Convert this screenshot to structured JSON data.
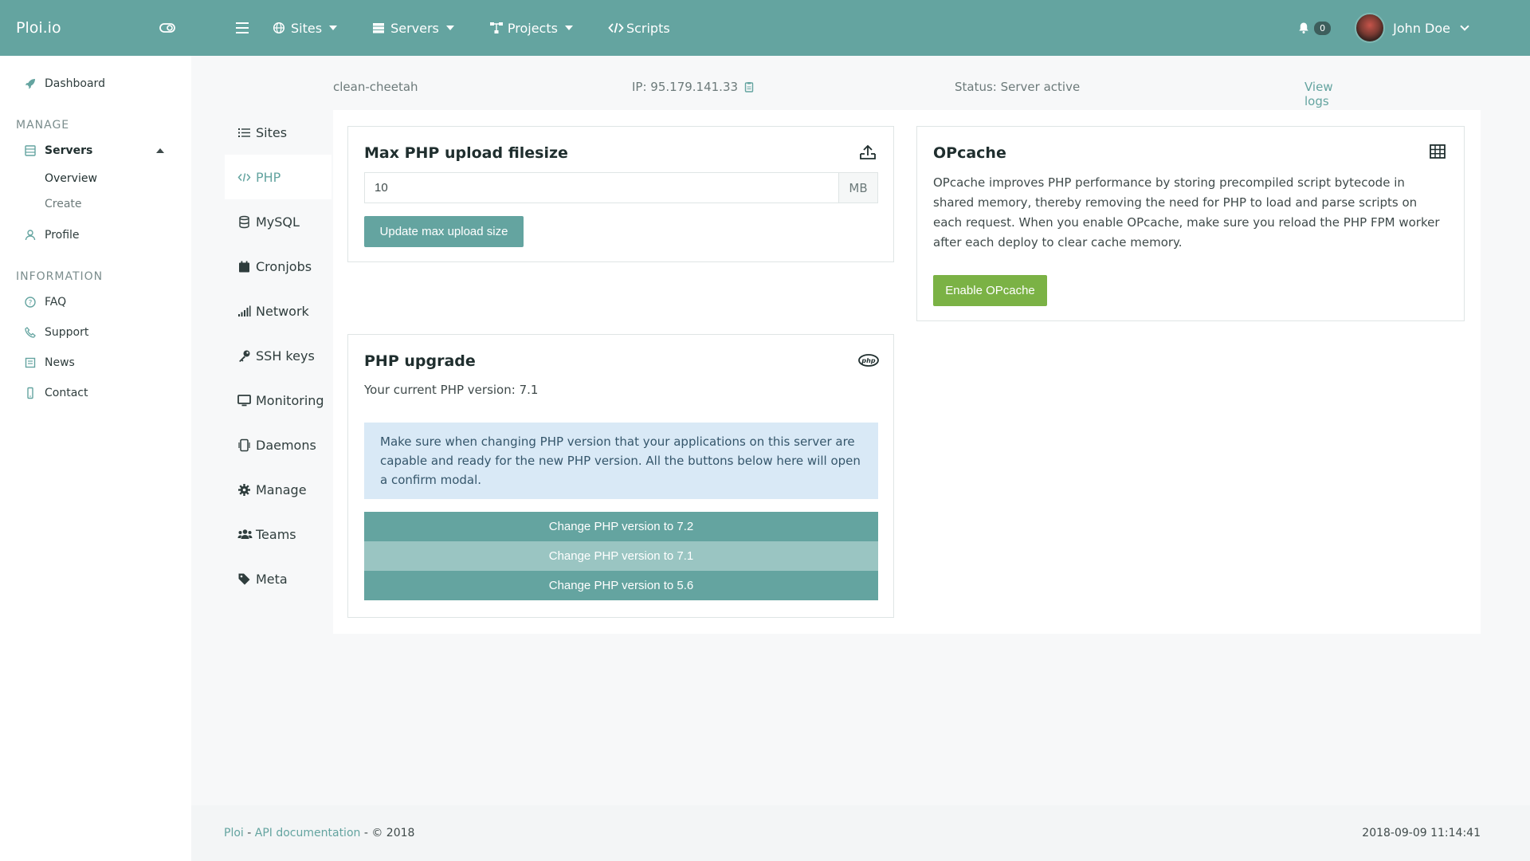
{
  "brand": {
    "name": "Ploi.io"
  },
  "sidebar": {
    "dashboard": "Dashboard",
    "manage_label": "MANAGE",
    "servers": "Servers",
    "servers_sub": [
      "Overview",
      "Create"
    ],
    "profile": "Profile",
    "information_label": "INFORMATION",
    "info_items": [
      "FAQ",
      "Support",
      "News",
      "Contact"
    ]
  },
  "topbar": {
    "menu": [
      {
        "label": "Sites",
        "icon": "globe-icon",
        "dropdown": true
      },
      {
        "label": "Servers",
        "icon": "server-icon",
        "dropdown": true
      },
      {
        "label": "Projects",
        "icon": "sitemap-icon",
        "dropdown": true
      },
      {
        "label": "Scripts",
        "icon": "code-icon",
        "dropdown": false
      }
    ],
    "notifications_count": "0",
    "user_name": "John Doe"
  },
  "server": {
    "name": "clean-cheetah",
    "ip": "IP: 95.179.141.33",
    "status": "Status: Server active",
    "view_logs": "View logs"
  },
  "subnav": [
    "Sites",
    "PHP",
    "MySQL",
    "Cronjobs",
    "Network",
    "SSH keys",
    "Monitoring",
    "Daemons",
    "Manage",
    "Teams",
    "Meta"
  ],
  "upload": {
    "title": "Max PHP upload filesize",
    "value": "10",
    "unit": "MB",
    "button": "Update max upload size"
  },
  "opcache": {
    "title": "OPcache",
    "description": "OPcache improves PHP performance by storing precompiled script bytecode in shared memory, thereby removing the need for PHP to load and parse scripts on each request. When you enable OPcache, make sure you reload the PHP FPM worker after each deploy to clear cache memory.",
    "button": "Enable OPcache"
  },
  "upgrade": {
    "title": "PHP upgrade",
    "current": "Your current PHP version: 7.1",
    "alert": "Make sure when changing PHP version that your applications on this server are capable and ready for the new PHP version. All the buttons below here will open a confirm modal.",
    "buttons": [
      "Change PHP version to 7.2",
      "Change PHP version to 7.1",
      "Change PHP version to 5.6"
    ]
  },
  "footer": {
    "ploi": "Ploi",
    "sep1": " - ",
    "api": "API documentation",
    "copyright": " - © 2018",
    "timestamp": "2018-09-09 11:14:41"
  },
  "colors": {
    "primary": "#64a4a0",
    "success": "#7bb245",
    "info_bg": "#d9e9f6"
  }
}
